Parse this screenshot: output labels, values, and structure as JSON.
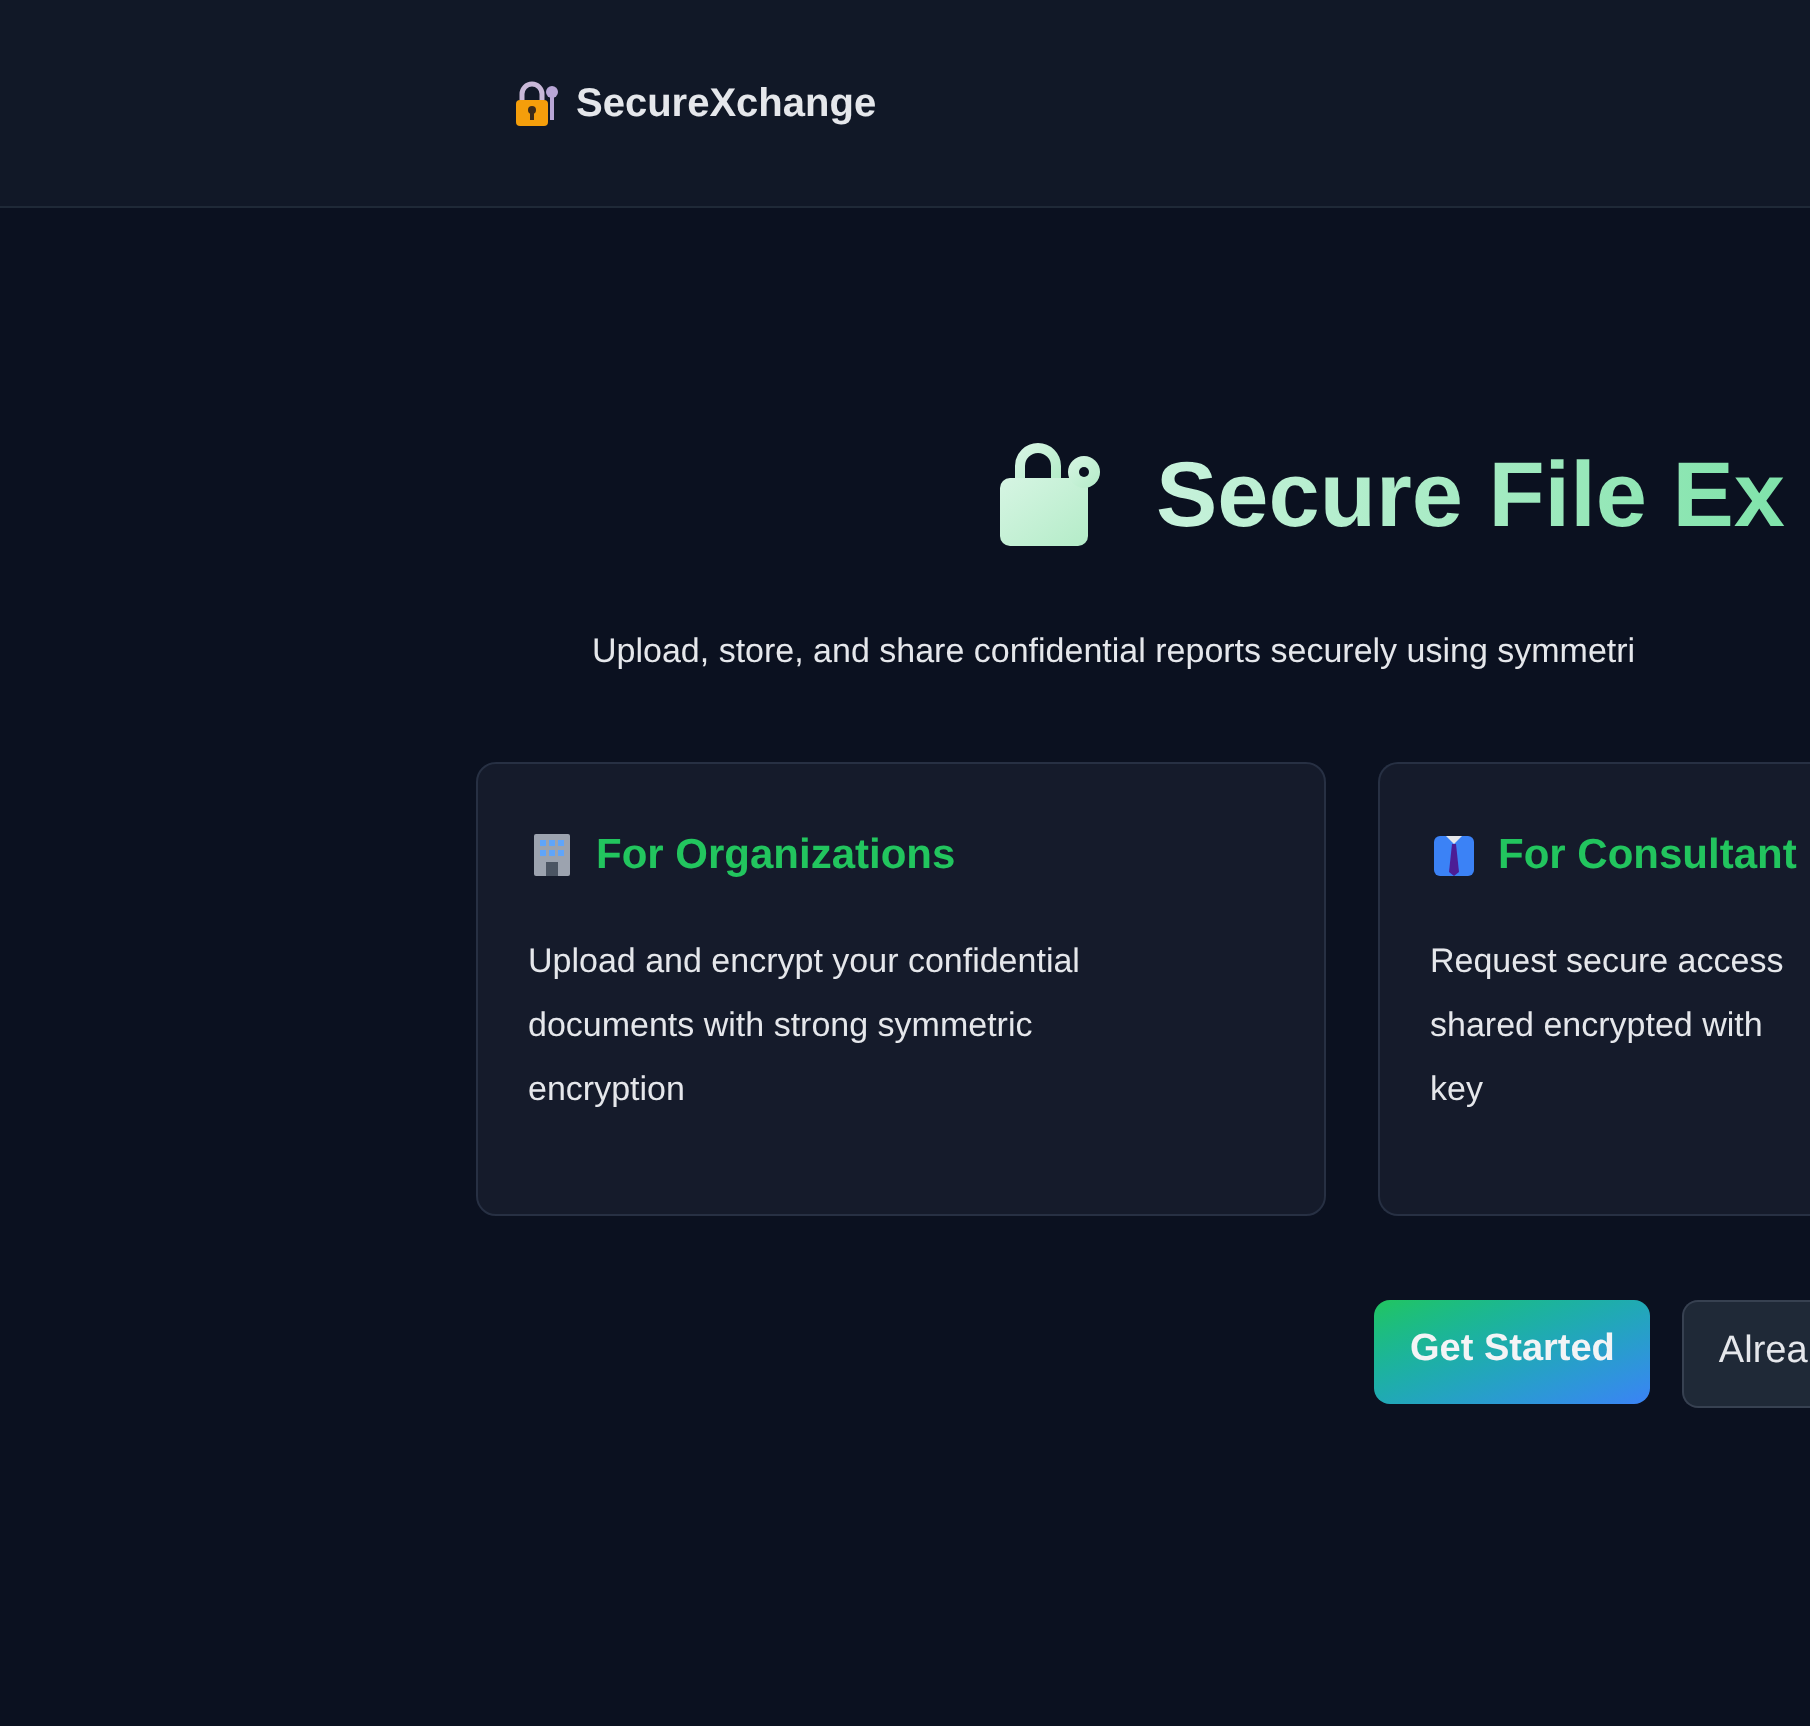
{
  "header": {
    "brand": "SecureXchange"
  },
  "hero": {
    "title": "Secure File Ex",
    "subtitle": "Upload, store, and share confidential reports securely using symmetri"
  },
  "cards": [
    {
      "kind": "building",
      "title": "For Organizations",
      "text": "Upload and encrypt your confidential documents with strong symmetric encryption"
    },
    {
      "kind": "tie",
      "title": "For Consultant",
      "lines": [
        "Request secure access",
        "shared encrypted with",
        "key"
      ]
    }
  ],
  "buttons": [
    {
      "kind": "primary",
      "label": "Get Started"
    },
    {
      "kind": "secondary",
      "label": "Alrea"
    }
  ]
}
